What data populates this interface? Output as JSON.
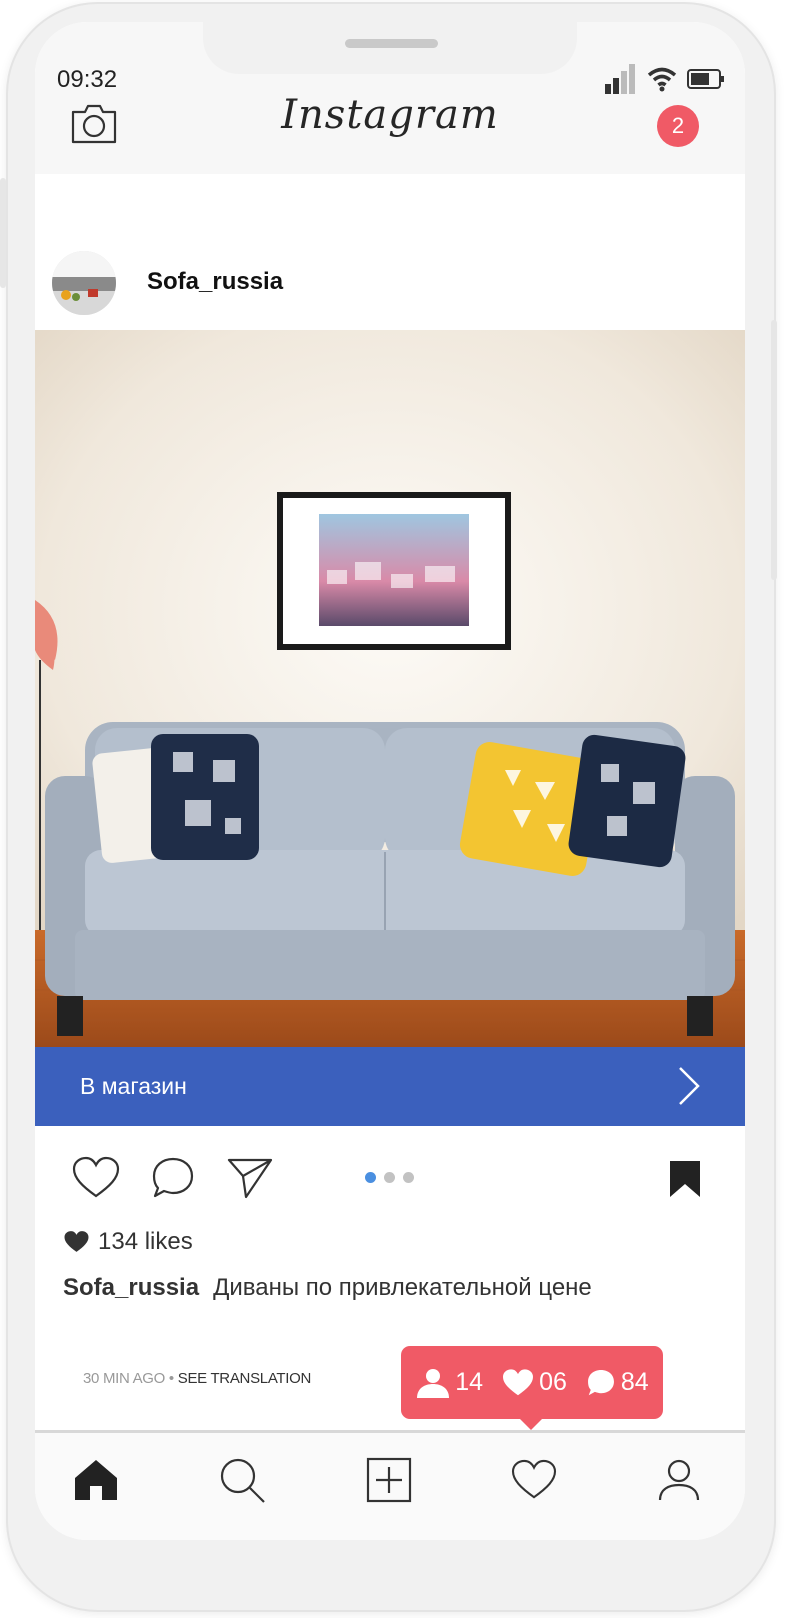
{
  "status_bar": {
    "time": "09:32"
  },
  "header": {
    "logo": "Instagram",
    "notification_count": "2"
  },
  "post": {
    "username": "Sofa_russia",
    "cta_label": "В магазин",
    "likes": "134 likes",
    "caption_user": "Sofa_russia",
    "caption_text": "Диваны по привлекательной цене",
    "time_ago": "30 MIN AGO",
    "separator": "•",
    "see_translation": "SEE TRANSLATION"
  },
  "activity_popup": {
    "followers": "14",
    "likes": "06",
    "comments": "84"
  },
  "colors": {
    "accent_red": "#f05a66",
    "cta_blue": "#3b60bd",
    "dot_active": "#4a8fe0"
  }
}
